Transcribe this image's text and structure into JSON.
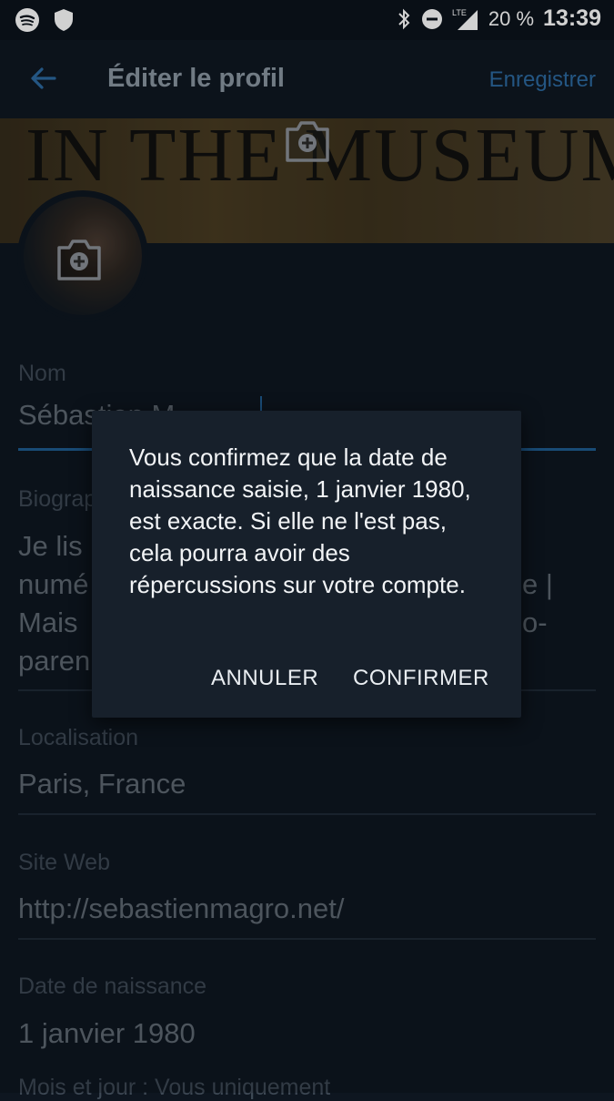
{
  "status_bar": {
    "battery": "20 %",
    "time": "13:39",
    "network": "LTE"
  },
  "app_bar": {
    "title": "Éditer le profil",
    "save_label": "Enregistrer"
  },
  "banner": {
    "text": "IN THE MUSEUM"
  },
  "form": {
    "name_label": "Nom",
    "name_value": "Sébastien M",
    "bio_label": "Biographie",
    "bio_lines": [
      "Je lis",
      "numé",
      "Mais",
      "paren"
    ],
    "bio_right_fragments": [
      "e |",
      "o-"
    ],
    "location_label": "Localisation",
    "location_value": "Paris, France",
    "website_label": "Site Web",
    "website_value": "http://sebastienmagro.net/",
    "birthdate_label": "Date de naissance",
    "birthdate_value": "1 janvier 1980",
    "footer_partial": "Mois et jour : Vous uniquement"
  },
  "dialog": {
    "message": "Vous confirmez que la date de naissance saisie, 1 janvier 1980, est exacte. Si elle ne l'est pas, cela pourra avoir des répercussions sur votre compte.",
    "cancel_label": "ANNULER",
    "confirm_label": "CONFIRMER"
  }
}
